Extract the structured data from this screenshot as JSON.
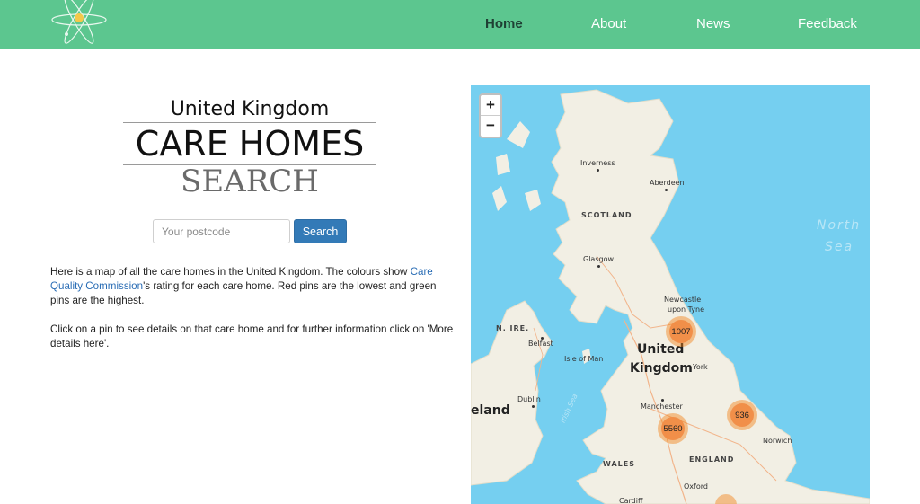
{
  "nav": {
    "home": "Home",
    "about": "About",
    "news": "News",
    "feedback": "Feedback"
  },
  "title": {
    "top": "United Kingdom",
    "main": "CARE HOMES",
    "sub": "SEARCH"
  },
  "search": {
    "placeholder": "Your postcode",
    "value": "",
    "button_label": "Search"
  },
  "description": {
    "p1_before": "Here is a map of all the care homes in the United Kingdom. The colours show ",
    "p1_link": "Care Quality Commission",
    "p1_after": "'s rating for each care home. Red pins are the lowest and green pins are the highest.",
    "p2": "Click on a pin to see details on that care home and for further information click on 'More details here'."
  },
  "map": {
    "zoom_in": "+",
    "zoom_out": "−",
    "clusters": [
      {
        "id": "1007",
        "label": "1007"
      },
      {
        "id": "936",
        "label": "936"
      },
      {
        "id": "5560",
        "label": "5560"
      }
    ],
    "labels": {
      "inverness": "Inverness",
      "aberdeen": "Aberdeen",
      "scotland": "SCOTLAND",
      "glasgow": "Glasgow",
      "north_sea_1": "North",
      "north_sea_2": "Sea",
      "newcastle_1": "Newcastle",
      "newcastle_2": "upon Tyne",
      "n_ire": "N. IRE.",
      "belfast": "Belfast",
      "isle_of_man": "Isle of Man",
      "uk_1": "United",
      "uk_2": "Kingdom",
      "york": "York",
      "irish_sea": "Irish Sea",
      "dublin": "Dublin",
      "ireland_fragment": "eland",
      "manchester": "Manchester",
      "norwich": "Norwich",
      "wales": "WALES",
      "england": "ENGLAND",
      "oxford": "Oxford",
      "cardiff": "Cardiff"
    },
    "colors": {
      "sea": "#75cff0",
      "land": "#f2efe4",
      "cluster": "#f08c46"
    }
  }
}
